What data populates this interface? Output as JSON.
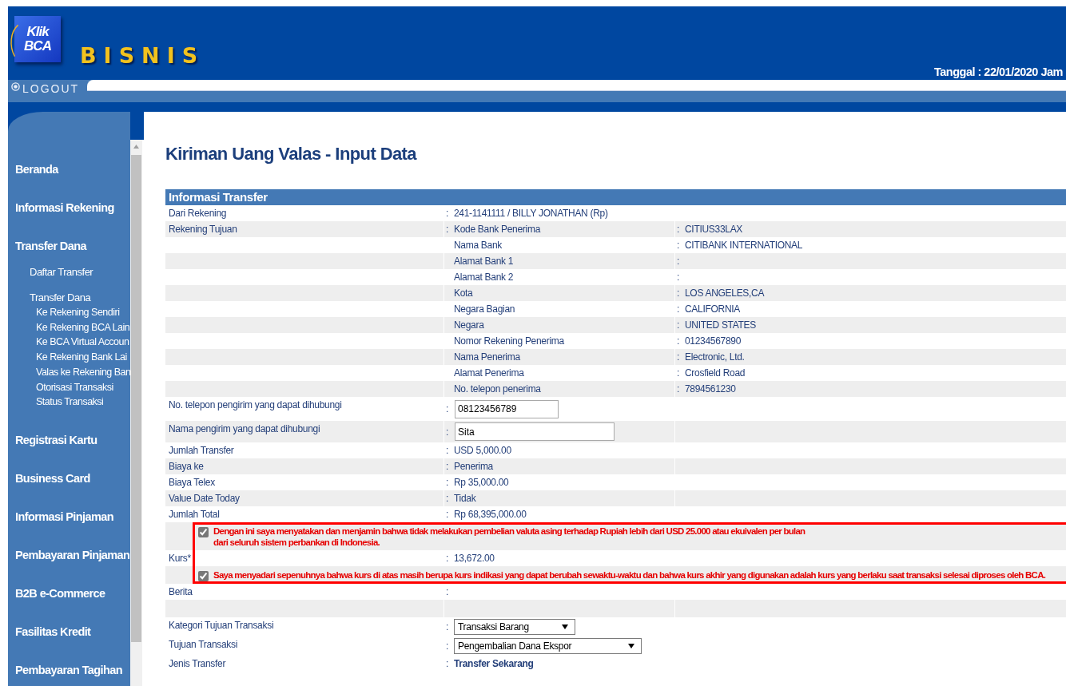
{
  "header": {
    "logo_lines": [
      "Klik",
      "BCA"
    ],
    "brand": "BISNIS",
    "logout": "LOGOUT",
    "date": "Tanggal : 22/01/2020 Jam"
  },
  "sidebar": {
    "items": [
      {
        "label": "Beranda"
      },
      {
        "label": "Informasi Rekening"
      },
      {
        "label": "Transfer Dana",
        "children": [
          {
            "label": "Daftar Transfer"
          },
          {
            "label": "Transfer Dana",
            "children": [
              {
                "label": "Ke Rekening Sendiri"
              },
              {
                "label": "Ke Rekening BCA Lain"
              },
              {
                "label": "Ke BCA Virtual Accoun"
              },
              {
                "label": "Ke Rekening Bank Lai"
              },
              {
                "label": "Valas ke Rekening Ban"
              },
              {
                "label": "Otorisasi Transaksi"
              },
              {
                "label": "Status Transaksi"
              }
            ]
          }
        ]
      },
      {
        "label": "Registrasi Kartu"
      },
      {
        "label": "Business Card"
      },
      {
        "label": "Informasi Pinjaman"
      },
      {
        "label": "Pembayaran Pinjaman"
      },
      {
        "label": "B2B e-Commerce"
      },
      {
        "label": "Fasilitas Kredit"
      },
      {
        "label": "Pembayaran Tagihan"
      }
    ]
  },
  "page_title": "Kiriman Uang Valas - Input Data",
  "section": {
    "title": "Informasi Transfer",
    "rows": [
      {
        "kind": "text",
        "label": "Dari Rekening",
        "sep": ":",
        "value": "241-1141111 / BILLY JONATHAN (Rp)"
      },
      {
        "kind": "recipient",
        "label": "Rekening Tujuan",
        "sep": ":",
        "field": "Kode Bank Penerima",
        "value_sep": ":",
        "value": "CITIUS33LAX"
      },
      {
        "kind": "recipient",
        "field": "Nama Bank",
        "value_sep": ":",
        "value": "CITIBANK INTERNATIONAL"
      },
      {
        "kind": "recipient",
        "field": "Alamat Bank 1",
        "value_sep": ":"
      },
      {
        "kind": "recipient",
        "field": "Alamat Bank 2",
        "value_sep": ":"
      },
      {
        "kind": "recipient",
        "field": "Kota",
        "value_sep": ":",
        "value": "LOS ANGELES,CA"
      },
      {
        "kind": "recipient",
        "field": "Negara Bagian",
        "value_sep": ":",
        "value": "CALIFORNIA"
      },
      {
        "kind": "recipient",
        "field": "Negara",
        "value_sep": ":",
        "value": "UNITED STATES"
      },
      {
        "kind": "recipient",
        "field": "Nomor Rekening Penerima",
        "value_sep": ":",
        "value": "01234567890"
      },
      {
        "kind": "recipient",
        "field": "Nama Penerima",
        "value_sep": ":",
        "value": "Electronic, Ltd."
      },
      {
        "kind": "recipient",
        "field": "Alamat Penerima",
        "value_sep": ":",
        "value": "Crosfield Road"
      },
      {
        "kind": "recipient",
        "field": "No. telepon penerima",
        "value_sep": ":",
        "value": "7894561230"
      },
      {
        "kind": "input",
        "label": "No. telepon pengirim yang dapat dihubungi",
        "sep": ":",
        "value": "08123456789"
      },
      {
        "kind": "input",
        "label": "Nama pengirim yang dapat dihubungi",
        "sep": ":",
        "value": "Sita"
      },
      {
        "kind": "text",
        "label": "Jumlah Transfer",
        "sep": ":",
        "value": "USD 5,000.00"
      },
      {
        "kind": "text",
        "label": "Biaya ke",
        "sep": ":",
        "value": "Penerima"
      },
      {
        "kind": "text",
        "label": "Biaya Telex",
        "sep": ":",
        "value": "Rp 35,000.00"
      },
      {
        "kind": "text",
        "label": "Value Date Today",
        "sep": ":",
        "value": "Tidak"
      },
      {
        "kind": "text",
        "label": "Jumlah Total",
        "sep": ":",
        "value": "Rp 68,395,000.00"
      },
      {
        "kind": "declaration",
        "checked": true,
        "lines": [
          "Dengan ini saya menyatakan dan menjamin bahwa tidak melakukan pembelian valuta asing terhadap Rupiah lebih dari USD 25.000 atau ekuivalen per bulan",
          "dari seluruh sistem perbankan di Indonesia."
        ]
      },
      {
        "kind": "text",
        "label": "Kurs*",
        "sep": ":",
        "value": "13,672.00"
      },
      {
        "kind": "declaration",
        "checked": true,
        "lines": [
          "Saya menyadari sepenuhnya bahwa kurs di atas masih berupa kurs indikasi yang dapat berubah sewaktu-waktu dan bahwa kurs akhir yang digunakan adalah kurs yang berlaku saat transaksi selesai diproses oleh BCA."
        ]
      },
      {
        "kind": "text",
        "label": "Berita",
        "sep": ":"
      },
      {
        "kind": "blank"
      },
      {
        "kind": "select",
        "label": "Kategori Tujuan Transaksi",
        "sep": ":",
        "value": "Transaksi Barang"
      },
      {
        "kind": "select",
        "label": "Tujuan Transaksi",
        "sep": ":",
        "value": "Pengembalian Dana Ekspor"
      },
      {
        "kind": "strong",
        "label": "Jenis Transfer",
        "sep": ":",
        "value": "Transfer Sekarang"
      }
    ]
  }
}
